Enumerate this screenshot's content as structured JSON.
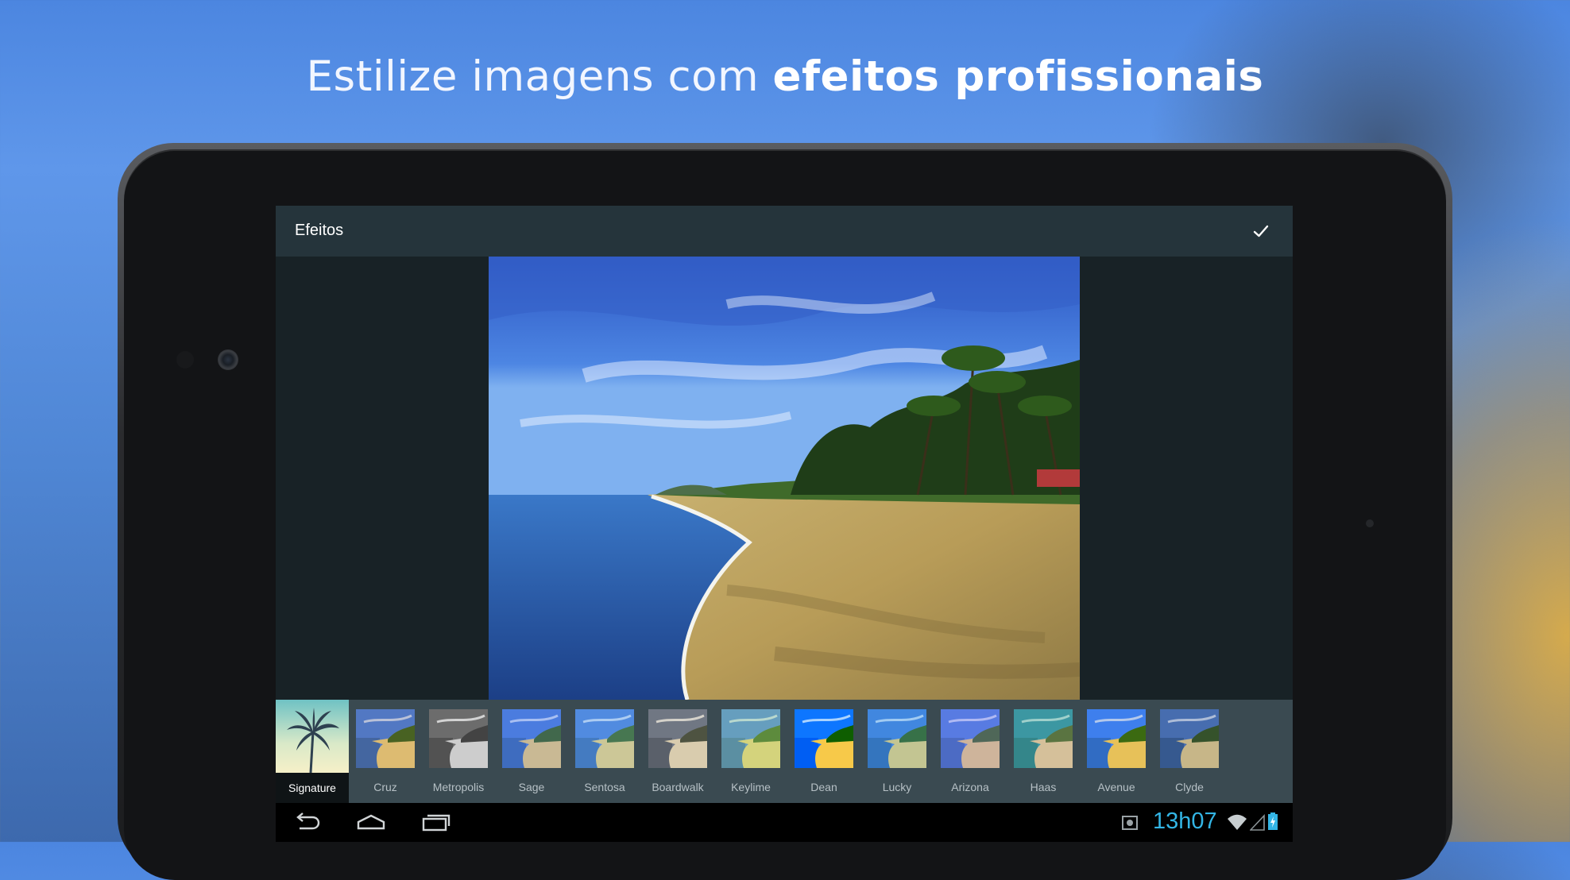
{
  "headline": {
    "regular": "Estilize imagens com ",
    "bold": "efeitos profissionais"
  },
  "actionbar": {
    "title": "Efeitos",
    "confirm_icon": "check-icon"
  },
  "effects": [
    {
      "label": "Signature",
      "selected": true
    },
    {
      "label": "Cruz"
    },
    {
      "label": "Metropolis"
    },
    {
      "label": "Sage"
    },
    {
      "label": "Sentosa"
    },
    {
      "label": "Boardwalk"
    },
    {
      "label": "Keylime"
    },
    {
      "label": "Dean"
    },
    {
      "label": "Lucky"
    },
    {
      "label": "Arizona"
    },
    {
      "label": "Haas"
    },
    {
      "label": "Avenue"
    },
    {
      "label": "Clyde"
    }
  ],
  "navbar": {
    "back_icon": "back-icon",
    "home_icon": "home-icon",
    "recents_icon": "recent-apps-icon"
  },
  "status": {
    "time": "13h07",
    "screenshot_icon": "screenshot-icon",
    "wifi_icon": "wifi-icon",
    "signal_icon": "signal-icon",
    "battery_icon": "battery-charging-icon"
  },
  "colors": {
    "accent": "#33b5e5",
    "actionbar": "#25343b",
    "strip": "#3a4a51",
    "screen_bg": "#182226"
  }
}
